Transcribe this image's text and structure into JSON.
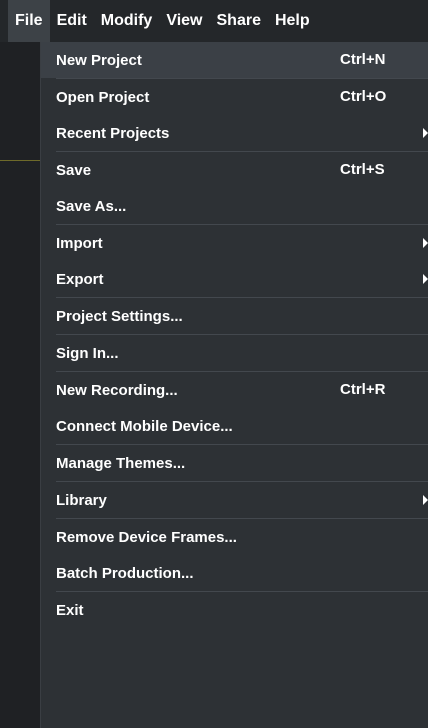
{
  "menubar": {
    "items": [
      {
        "label": "File"
      },
      {
        "label": "Edit"
      },
      {
        "label": "Modify"
      },
      {
        "label": "View"
      },
      {
        "label": "Share"
      },
      {
        "label": "Help"
      }
    ]
  },
  "file_menu": {
    "new_project": {
      "label": "New Project",
      "shortcut": "Ctrl+N"
    },
    "open_project": {
      "label": "Open Project",
      "shortcut": "Ctrl+O"
    },
    "recent_projects": {
      "label": "Recent Projects"
    },
    "save": {
      "label": "Save",
      "shortcut": "Ctrl+S"
    },
    "save_as": {
      "label": "Save As..."
    },
    "import": {
      "label": "Import"
    },
    "export": {
      "label": "Export"
    },
    "project_settings": {
      "label": "Project Settings..."
    },
    "sign_in": {
      "label": "Sign In..."
    },
    "new_recording": {
      "label": "New Recording...",
      "shortcut": "Ctrl+R"
    },
    "connect_mobile": {
      "label": "Connect Mobile Device..."
    },
    "manage_themes": {
      "label": "Manage Themes..."
    },
    "library": {
      "label": "Library"
    },
    "remove_device_frames": {
      "label": "Remove Device Frames..."
    },
    "batch_production": {
      "label": "Batch Production..."
    },
    "exit": {
      "label": "Exit"
    }
  },
  "colors": {
    "menubar_bg": "#24272a",
    "menu_bg": "#2d3135",
    "highlight_bg": "#3b4046",
    "separator": "#43484e",
    "text": "#ffffff"
  }
}
